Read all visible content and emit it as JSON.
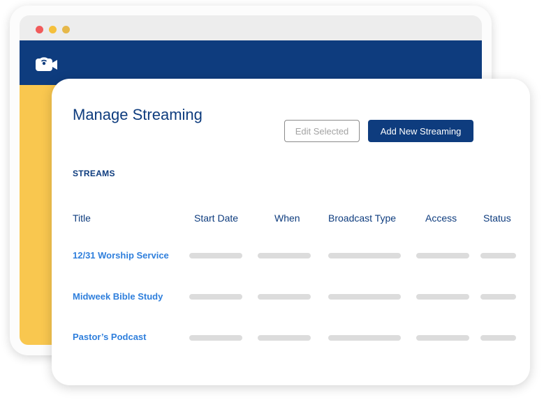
{
  "window": {
    "controls": [
      "close",
      "minimize",
      "maximize"
    ],
    "logo_icon": "streaming-camera-icon"
  },
  "colors": {
    "navbar": "#0e3c7e",
    "accent_panel": "#f9c74f",
    "primary_button": "#0e3c7e",
    "link": "#2f7fdc"
  },
  "page": {
    "title": "Manage Streaming",
    "edit_selected_label": "Edit Selected",
    "add_new_label": "Add New Streaming",
    "section_label": "STREAMS"
  },
  "table": {
    "columns": [
      "Title",
      "Start Date",
      "When",
      "Broadcast Type",
      "Access",
      "Status"
    ],
    "rows": [
      {
        "title": "12/31 Worship Service"
      },
      {
        "title": "Midweek Bible Study"
      },
      {
        "title": "Pastor’s Podcast"
      }
    ]
  }
}
